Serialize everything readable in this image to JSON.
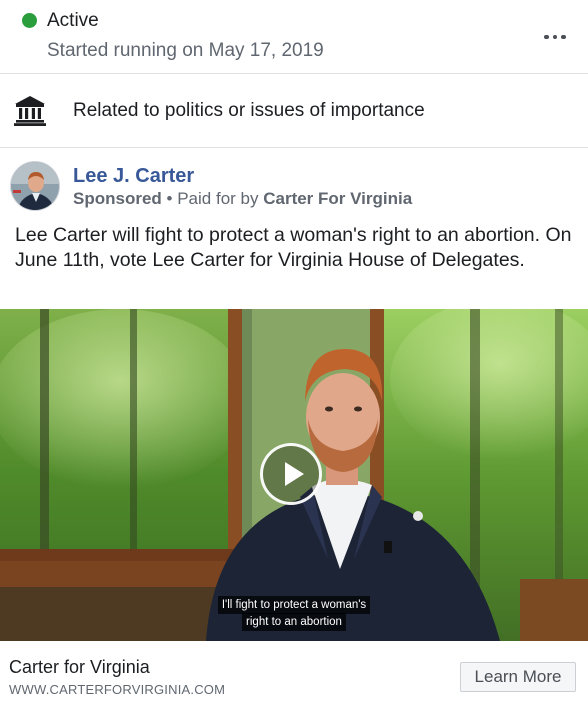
{
  "status": {
    "label": "Active",
    "started": "Started running on May 17, 2019",
    "color": "#2a9d3d"
  },
  "more_menu": {
    "icon": "more-horizontal-icon"
  },
  "category": {
    "icon": "government-building-icon",
    "label": "Related to politics or issues of importance"
  },
  "post": {
    "page_name": "Lee J. Carter",
    "sponsored": "Sponsored",
    "separator": "•",
    "paid_for_prefix": "Paid for by",
    "paid_for_name": "Carter For Virginia",
    "text": "Lee Carter will fight to protect a woman's right to an abortion. On June 11th, vote Lee Carter for Virginia House of Delegates.",
    "name_color": "#385898"
  },
  "video": {
    "play_icon": "play-icon",
    "captions": [
      "I'll fight to protect a woman's",
      "right to an abortion"
    ]
  },
  "footer": {
    "title": "Carter for Virginia",
    "url": "WWW.CARTERFORVIRGINIA.COM",
    "cta_label": "Learn More"
  }
}
